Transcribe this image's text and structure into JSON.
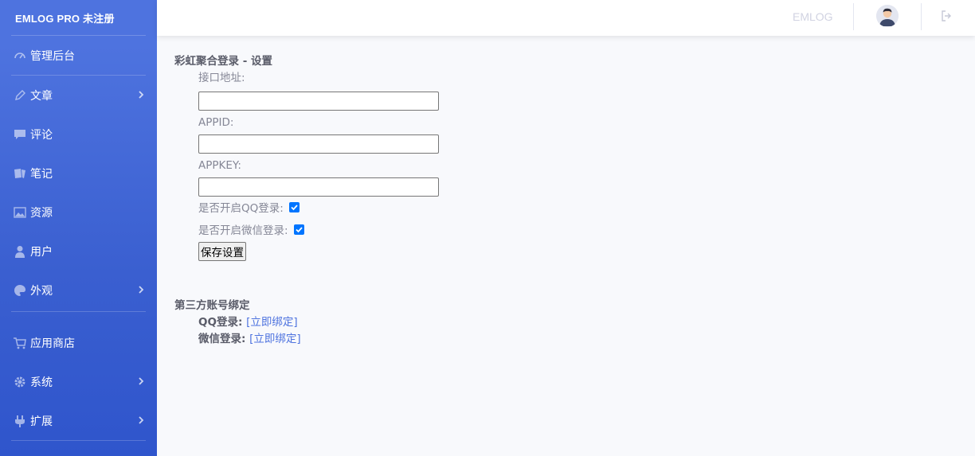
{
  "brand": "EMLOG PRO 未注册",
  "sidebar": {
    "items": [
      {
        "label": "管理后台",
        "icon": "dashboard-gauge-icon"
      },
      {
        "label": "文章",
        "icon": "pencil-icon",
        "has_sub": true
      },
      {
        "label": "评论",
        "icon": "comment-icon"
      },
      {
        "label": "笔记",
        "icon": "note-icon"
      },
      {
        "label": "资源",
        "icon": "image-icon"
      },
      {
        "label": "用户",
        "icon": "user-icon"
      },
      {
        "label": "外观",
        "icon": "palette-icon",
        "has_sub": true
      },
      {
        "label": "应用商店",
        "icon": "cart-icon"
      },
      {
        "label": "系统",
        "icon": "gear-icon",
        "has_sub": true
      },
      {
        "label": "扩展",
        "icon": "plug-icon",
        "has_sub": true
      }
    ]
  },
  "topbar": {
    "site_link": "EMLOG"
  },
  "settings": {
    "title": "彩虹聚合登录 - 设置",
    "api_url_label": "接口地址:",
    "api_url_value": "",
    "appid_label": "APPID:",
    "appid_value": "",
    "appkey_label": "APPKEY:",
    "appkey_value": "",
    "qq_toggle_label": "是否开启QQ登录:",
    "qq_enabled": true,
    "wechat_toggle_label": "是否开启微信登录:",
    "wechat_enabled": true,
    "save_label": "保存设置"
  },
  "binding": {
    "title": "第三方账号绑定",
    "qq_label": "QQ登录:",
    "qq_link": "[立即绑定]",
    "wechat_label": "微信登录:",
    "wechat_link": "[立即绑定]"
  },
  "colors": {
    "sidebar_top": "#4e73df",
    "link": "#4e73df",
    "checkbox": "#0075ff"
  }
}
